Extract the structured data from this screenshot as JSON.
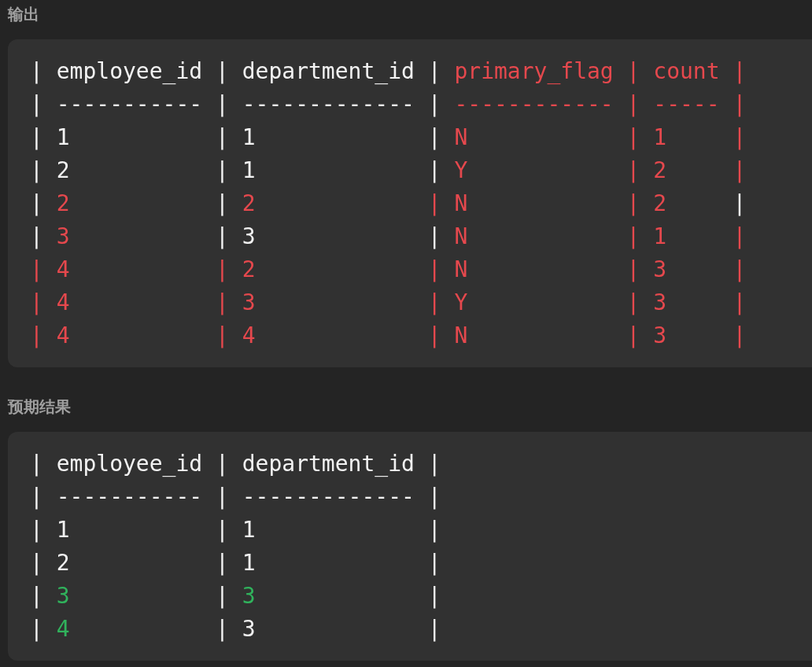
{
  "sections": [
    {
      "title": "输出",
      "lines": [
        [
          {
            "text": "| employee_id | department_id | ",
            "kind": "plain"
          },
          {
            "text": "primary_flag | count |",
            "kind": "wrong"
          }
        ],
        [
          {
            "text": "| ----------- | ------------- | ",
            "kind": "plain"
          },
          {
            "text": "------------ | ----- |",
            "kind": "wrong"
          }
        ],
        [
          {
            "text": "| 1           | 1             | ",
            "kind": "plain"
          },
          {
            "text": "N            | 1     |",
            "kind": "wrong"
          }
        ],
        [
          {
            "text": "| 2           | 1             | ",
            "kind": "plain"
          },
          {
            "text": "Y            | 2     |",
            "kind": "wrong"
          }
        ],
        [
          {
            "text": "| ",
            "kind": "plain"
          },
          {
            "text": "2",
            "kind": "wrong"
          },
          {
            "text": "           | ",
            "kind": "plain"
          },
          {
            "text": "2             | N            | 2",
            "kind": "wrong"
          },
          {
            "text": "     |",
            "kind": "plain"
          }
        ],
        [
          {
            "text": "| ",
            "kind": "plain"
          },
          {
            "text": "3",
            "kind": "wrong"
          },
          {
            "text": "           | 3             | ",
            "kind": "plain"
          },
          {
            "text": "N            | 1     |",
            "kind": "wrong"
          }
        ],
        [
          {
            "text": "| 4           | 2             | N            | 3     |",
            "kind": "wrong"
          }
        ],
        [
          {
            "text": "| 4           | 3             | Y            | 3     |",
            "kind": "wrong"
          }
        ],
        [
          {
            "text": "| 4           | 4             | N            | 3     |",
            "kind": "wrong"
          }
        ]
      ]
    },
    {
      "title": "预期结果",
      "lines": [
        [
          {
            "text": "| employee_id | department_id |",
            "kind": "plain"
          }
        ],
        [
          {
            "text": "| ----------- | ------------- |",
            "kind": "plain"
          }
        ],
        [
          {
            "text": "| 1           | 1             |",
            "kind": "plain"
          }
        ],
        [
          {
            "text": "| 2           | 1             |",
            "kind": "plain"
          }
        ],
        [
          {
            "text": "| ",
            "kind": "plain"
          },
          {
            "text": "3",
            "kind": "right"
          },
          {
            "text": "           | ",
            "kind": "plain"
          },
          {
            "text": "3",
            "kind": "right"
          },
          {
            "text": "             |",
            "kind": "plain"
          }
        ],
        [
          {
            "text": "| ",
            "kind": "plain"
          },
          {
            "text": "4",
            "kind": "right"
          },
          {
            "text": "           | 3             |",
            "kind": "plain"
          }
        ]
      ]
    }
  ]
}
